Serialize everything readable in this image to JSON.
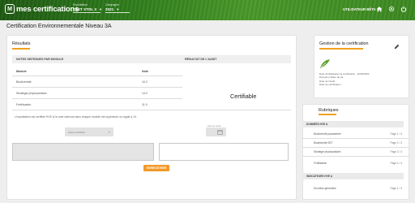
{
  "app": {
    "logo_badge": "M",
    "logo": "mes certifications"
  },
  "header": {
    "exploitation_label": "Exploitation",
    "exploitation_value": "TEST XTOL 3",
    "campagne_label": "Campagne",
    "campagne_value": "2021",
    "user": "UTILISATEUR BÊTA"
  },
  "page": {
    "title": "Certification Environnementale Niveau 3A"
  },
  "results": {
    "title": "Résultats",
    "col_notes": "NOTES OBTENUES PAR MODULE",
    "col_result": "RÉSULTAT DE L'AUDIT",
    "sub_module": "Module",
    "sub_note": "Note",
    "rows": [
      {
        "module": "Biodiversité",
        "note": "10.2"
      },
      {
        "module": "Stratégie phytosanitaire",
        "note": "14.2"
      },
      {
        "module": "Fertilisation",
        "note": "11.0"
      }
    ],
    "result_value": "Certifiable",
    "note_text": "L'exploitation est certifiée HVE si la note obtenue dans chaque module est supérieure ou égale à 10.",
    "select_value": "Aucun certificat",
    "date_label": "Date de l'audit",
    "save_button": "ENREGISTRER"
  },
  "management": {
    "title": "Gestion de la certification",
    "lines": [
      "Date d'initialisation la certification : 22/02/2022",
      "Période prolifée de pa",
      "Date de l'audit :",
      "Date de certification :"
    ]
  },
  "rubriques": {
    "title": "Rubriques",
    "groups": [
      {
        "name": "DONNÉES HVE A",
        "items": [
          {
            "label": "Biodiversité paramétrée",
            "page": "Page 1 / 4"
          },
          {
            "label": "Biodiversité SET",
            "page": "Page 2 / 4"
          },
          {
            "label": "Stratégie phytosanitaire",
            "page": "Page 3 / 4"
          },
          {
            "label": "Fertilisation",
            "page": "Page 4 / 4"
          }
        ]
      },
      {
        "name": "INDICATEURS HVE A",
        "items": [
          {
            "label": "Données générales",
            "page": "Page 1 / 4"
          }
        ]
      }
    ]
  },
  "colors": {
    "accent": "#f0a020",
    "header_green": "#2f7d1c"
  }
}
